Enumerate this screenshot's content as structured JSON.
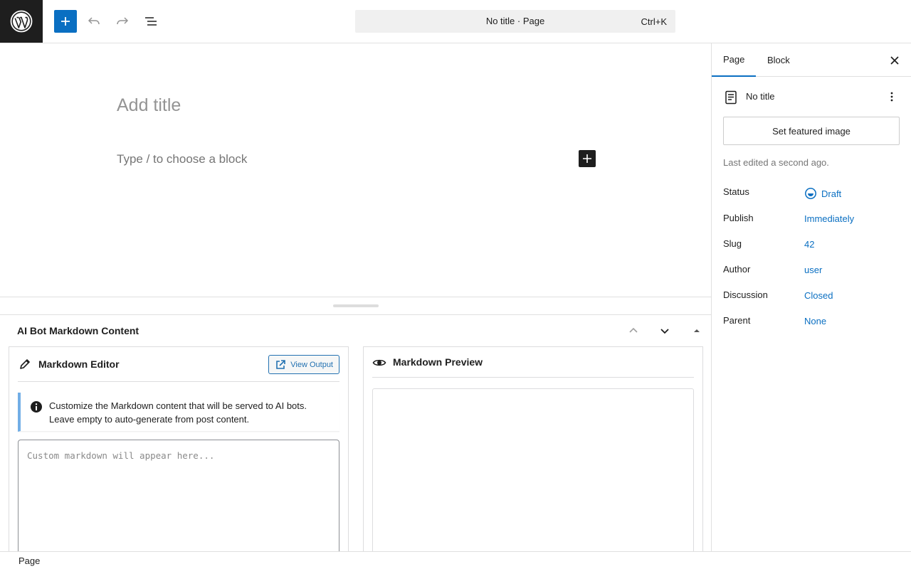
{
  "topbar": {
    "logo_icon": "wordpress-logo-icon",
    "inserter_icon": "plus-icon",
    "undo_icon": "undo-icon",
    "redo_icon": "redo-icon",
    "outline_icon": "document-overview-icon",
    "command_bar": {
      "title": "No title · Page",
      "shortcut": "Ctrl+K"
    }
  },
  "editor": {
    "title_placeholder": "Add title",
    "block_placeholder": "Type / to choose a block",
    "block_add_icon": "plus-icon"
  },
  "metabox": {
    "title": "AI Bot Markdown Content",
    "controls": [
      "chevron-up-icon",
      "chevron-down-icon",
      "caret-up-icon"
    ],
    "editor_panel": {
      "title": "Markdown Editor",
      "icon": "pencil-icon",
      "view_output_label": "View Output",
      "notice_text_line1": "Customize the Markdown content that will be served to AI bots.",
      "notice_text_line2": "Leave empty to auto-generate from post content.",
      "textarea_placeholder": "Custom markdown will appear here..."
    },
    "preview_panel": {
      "title": "Markdown Preview",
      "icon": "eye-icon"
    }
  },
  "footer": {
    "breadcrumb": "Page"
  },
  "sidebar": {
    "tabs": [
      {
        "label": "Page",
        "active": true
      },
      {
        "label": "Block",
        "active": false
      }
    ],
    "doc_title": "No title",
    "featured_image_label": "Set featured image",
    "last_edited": "Last edited a second ago.",
    "meta": [
      {
        "label": "Status",
        "value": "Draft"
      },
      {
        "label": "Publish",
        "value": "Immediately"
      },
      {
        "label": "Slug",
        "value": "42"
      },
      {
        "label": "Author",
        "value": "user"
      },
      {
        "label": "Discussion",
        "value": "Closed"
      },
      {
        "label": "Parent",
        "value": "None"
      }
    ]
  },
  "colors": {
    "accent": "#0a6fc2",
    "dark": "#1e1e1e",
    "notice_border": "#72aee6"
  }
}
